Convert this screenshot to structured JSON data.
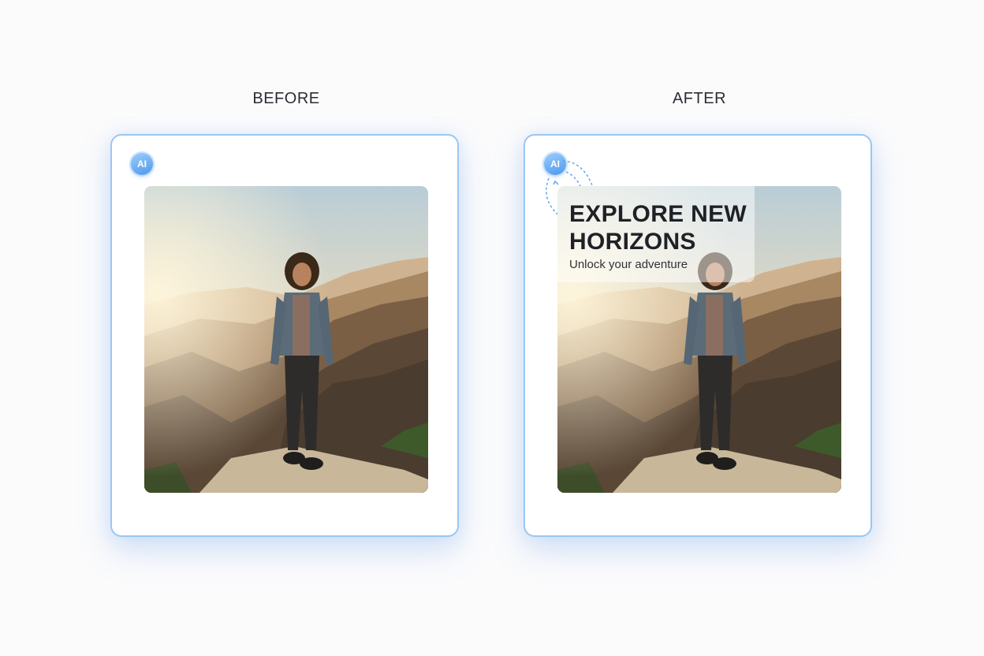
{
  "labels": {
    "before": "BEFORE",
    "after": "AFTER"
  },
  "badge": {
    "text": "AI"
  },
  "overlay": {
    "headline": "EXPLORE NEW HORIZONS",
    "subline": "Unlock your adventure"
  },
  "colors": {
    "accent": "#9cc6f2",
    "badge": "#4e98ec",
    "background": "#fbfbfc"
  }
}
